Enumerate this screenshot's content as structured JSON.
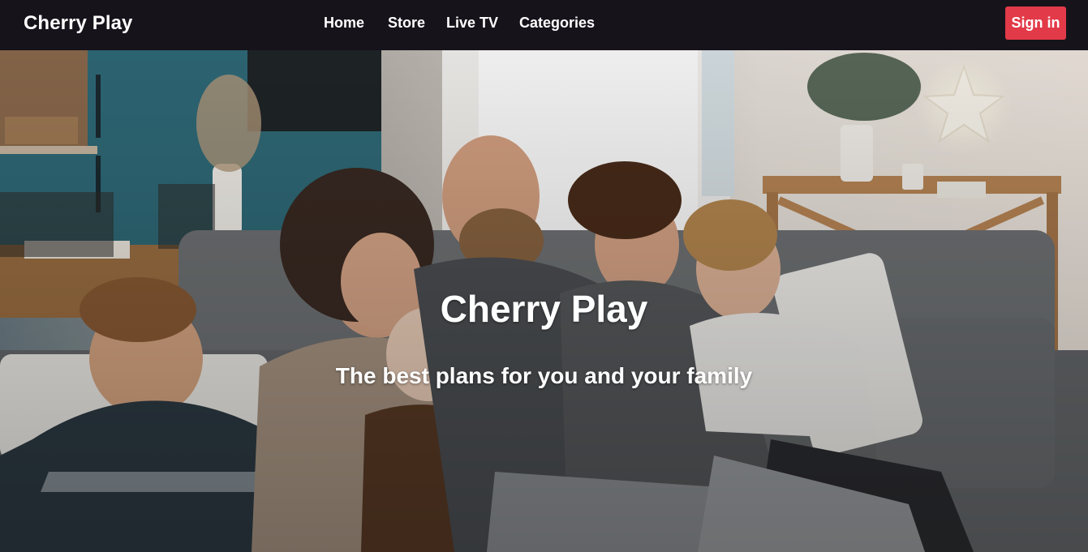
{
  "nav": {
    "brand": "Cherry Play",
    "links": [
      {
        "label": "Home"
      },
      {
        "label": "Store"
      },
      {
        "label": "Live TV"
      },
      {
        "label": "Categories"
      }
    ],
    "signin_label": "Sign in"
  },
  "hero": {
    "title": "Cherry Play",
    "subtitle": "The best plans for you and your family"
  },
  "colors": {
    "navbar_bg": "#16131b",
    "accent": "#e23a48",
    "text": "#ffffff"
  }
}
